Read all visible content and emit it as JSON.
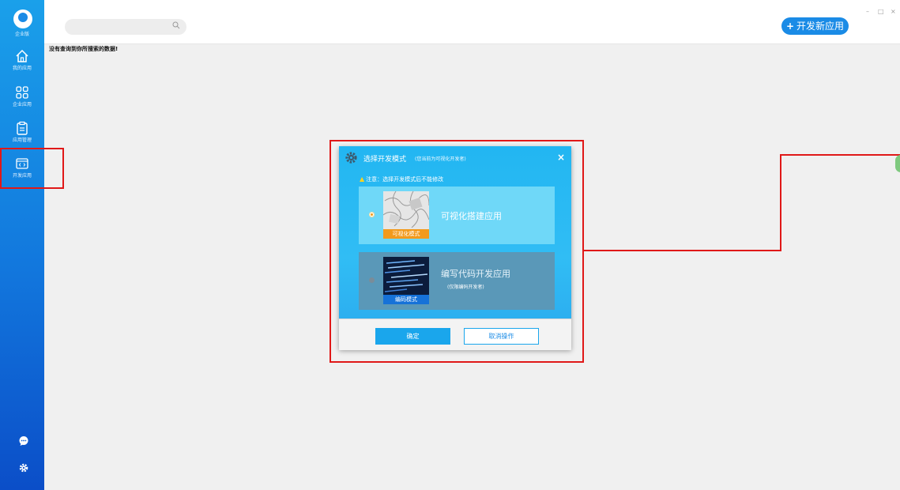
{
  "sidebar": {
    "logo_label": "企业版",
    "items": [
      {
        "label": "我的应用",
        "icon": "home-icon"
      },
      {
        "label": "企业应用",
        "icon": "grid-icon"
      },
      {
        "label": "应用管理",
        "icon": "clipboard-icon"
      },
      {
        "label": "开发应用",
        "icon": "code-window-icon"
      }
    ],
    "bottom_icons": [
      "chat-icon",
      "settings-icon"
    ]
  },
  "header": {
    "search_placeholder": "",
    "new_app_button": "开发新应用",
    "window_controls": [
      "–",
      "□",
      "×"
    ]
  },
  "main": {
    "empty_notice": "没有查询到你所搜索的数据!"
  },
  "dialog": {
    "title": "选择开发模式",
    "subtitle": "(您当前为可视化开发者)",
    "close": "×",
    "warning": "注意：选择开发模式后不能修改",
    "modes": [
      {
        "label": "可视化搭建应用",
        "tag": "可视化模式",
        "selected": true
      },
      {
        "label": "编写代码开发应用",
        "tag": "编码模式",
        "note": "(仅限编码开发者)",
        "selected": false
      }
    ],
    "confirm_button": "确定",
    "cancel_button": "取消操作"
  },
  "colors": {
    "sidebar_top": "#1aa0ea",
    "sidebar_bottom": "#0b4ec8",
    "dialog_bg": "#31bdf4",
    "highlight": "#e01818",
    "selected_tag": "#f29a1c",
    "accent": "#1a8be6"
  }
}
